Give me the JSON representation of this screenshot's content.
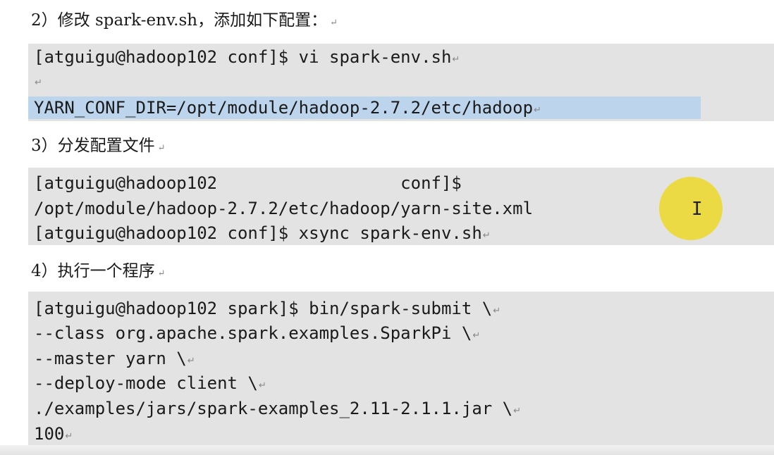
{
  "para_mark": "↵",
  "sections": [
    {
      "heading": "2）修改 spark-env.sh，添加如下配置：",
      "lines": [
        "[atguigu@hadoop102 conf]$ vi spark-env.sh",
        "",
        "YARN_CONF_DIR=/opt/module/hadoop-2.7.2/etc/hadoop"
      ]
    },
    {
      "heading": "3）分发配置文件",
      "lines": [
        "[atguigu@hadoop102                  conf]$",
        "/opt/module/hadoop-2.7.2/etc/hadoop/yarn-site.xml",
        "[atguigu@hadoop102 conf]$ xsync spark-env.sh"
      ]
    },
    {
      "heading": "4）执行一个程序",
      "lines": [
        "[atguigu@hadoop102 spark]$ bin/spark-submit \\",
        "--class org.apache.spark.examples.SparkPi \\",
        "--master yarn \\",
        "--deploy-mode client \\",
        "./examples/jars/spark-examples_2.11-2.1.1.jar \\",
        "100"
      ]
    }
  ],
  "colors": {
    "code_background": "#e3e3e3",
    "selection": "#bcd4ec",
    "cursor_highlight": "#ecd828",
    "spellcheck_underline": "#d03030"
  }
}
